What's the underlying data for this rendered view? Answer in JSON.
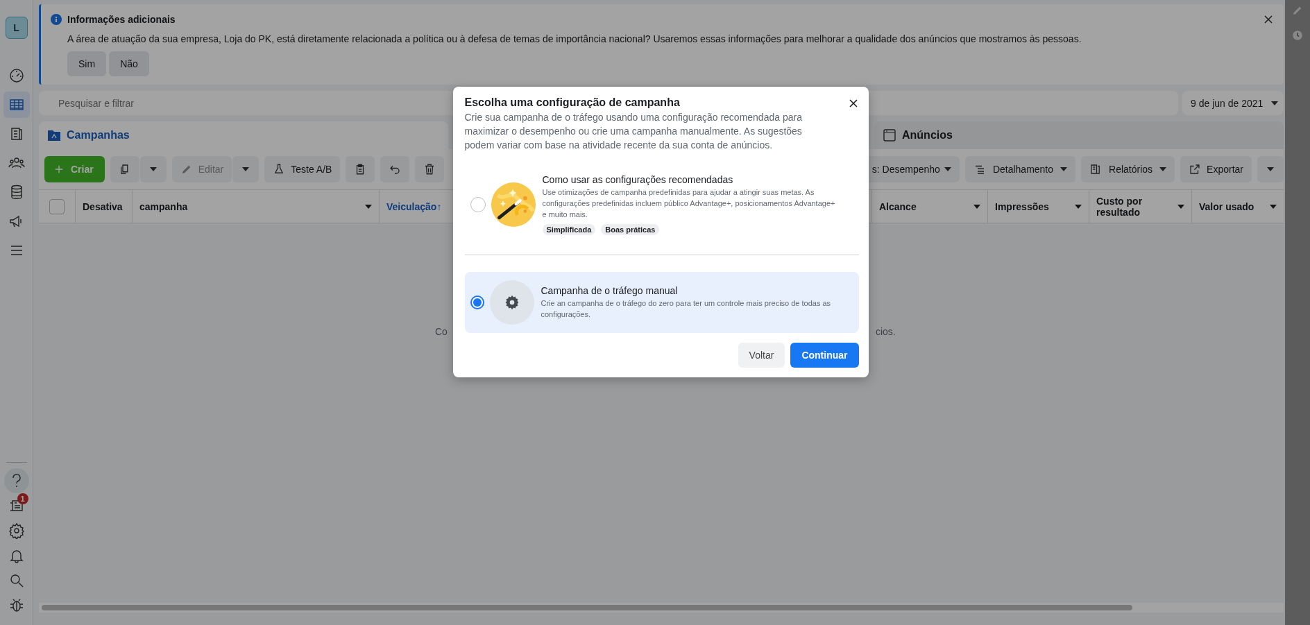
{
  "sidebar": {
    "avatar": "L",
    "items": [
      {
        "kind": "gauge",
        "selected": false
      },
      {
        "kind": "table",
        "selected": true
      },
      {
        "kind": "pages",
        "selected": false
      },
      {
        "kind": "people",
        "selected": false
      },
      {
        "kind": "database",
        "selected": false
      },
      {
        "kind": "megaphone",
        "selected": false
      },
      {
        "kind": "menu",
        "selected": false
      }
    ],
    "bottom_items": [
      {
        "kind": "help",
        "selected": true
      },
      {
        "kind": "news",
        "selected": false,
        "badge": "1"
      },
      {
        "kind": "settings",
        "selected": false
      },
      {
        "kind": "bell",
        "selected": false
      },
      {
        "kind": "search",
        "selected": false
      },
      {
        "kind": "bug",
        "selected": false
      }
    ]
  },
  "banner": {
    "title": "Informações adicionais",
    "text": "A área de atuação da sua empresa, Loja do PK, está diretamente relacionada a política ou à defesa de temas de importância nacional? Usaremos essas informações para melhorar a qualidade dos anúncios que mostramos às pessoas.",
    "buttons": [
      "Sim",
      "Não"
    ]
  },
  "search": {
    "placeholder": "Pesquisar e filtrar"
  },
  "date_range": "9 de jun de 2021",
  "tabs": [
    {
      "label": "Campanhas",
      "selected": true
    },
    {
      "label": "Anúncios",
      "selected": false
    }
  ],
  "toolbar_left": [
    {
      "kind": "create",
      "label": "Criar",
      "disabled": false,
      "menu": false
    },
    {
      "kind": "duplicate",
      "disabled": false,
      "menu": true
    },
    {
      "kind": "edit",
      "label": "Editar",
      "disabled": true,
      "menu": true
    },
    {
      "kind": "abtest",
      "label": "Teste A/B",
      "disabled": false,
      "menu": false
    },
    {
      "kind": "clipboard",
      "disabled": false,
      "menu": false
    },
    {
      "kind": "undo",
      "disabled": false,
      "menu": false
    },
    {
      "kind": "delete",
      "disabled": false,
      "menu": false
    }
  ],
  "toolbar_right": [
    {
      "kind": "columns",
      "label": "s: Desempenho",
      "menu": true
    },
    {
      "kind": "breakdown",
      "label": "Detalhamento",
      "menu": true
    },
    {
      "kind": "reports",
      "label": "Relatórios",
      "menu": true
    },
    {
      "kind": "export",
      "label": "Exportar",
      "menu": false
    },
    {
      "kind": "more",
      "menu": true
    }
  ],
  "select_all": {
    "checked": false
  },
  "columns_left": [
    {
      "label": "Desativa",
      "sorted": false,
      "menu": false
    },
    {
      "label": "campanha",
      "sorted": false,
      "menu": true
    },
    {
      "label": "Veiculação",
      "sort_arrow": "↑",
      "sorted": true,
      "menu": false
    }
  ],
  "columns_right": [
    {
      "label": "Alcance",
      "sorted": false,
      "menu": true
    },
    {
      "label": "Impressões",
      "sorted": false,
      "menu": true
    },
    {
      "label": "Custo por resultado",
      "sorted": false,
      "menu": true
    },
    {
      "label": "Valor usado",
      "sorted": false,
      "menu": true
    }
  ],
  "empty_message_start": "Co",
  "empty_message_end": "cios.",
  "dialog": {
    "title": "Escolha uma configuração de campanha",
    "description": "Crie sua campanha de o tráfego usando uma configuração recomendada para maximizar o desempenho ou crie uma campanha manualmente. As sugestões podem variar com base na atividade recente da sua conta de anúncios.",
    "options": [
      {
        "kind": "recommended",
        "title": "Como usar as configurações recomendadas",
        "text": "Use otimizações de campanha predefinidas para ajudar a atingir suas metas. As configurações predefinidas incluem público Advantage+, posicionamentos Advantage+ e muito mais.",
        "tags": [
          "Simplificada",
          "Boas práticas"
        ],
        "selected": false
      },
      {
        "kind": "manual",
        "title": "Campanha de o tráfego manual",
        "text": "Crie an campanha de o tráfego do zero para ter um controle mais preciso de todas as configurações.",
        "selected": true
      }
    ],
    "buttons": [
      {
        "label": "Voltar",
        "kind": "secondary"
      },
      {
        "label": "Continuar",
        "kind": "primary"
      }
    ]
  }
}
